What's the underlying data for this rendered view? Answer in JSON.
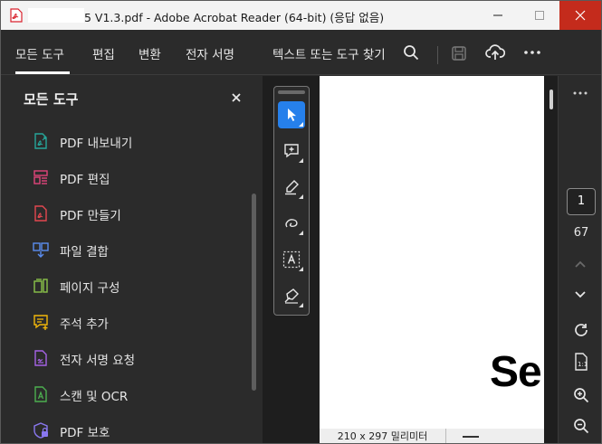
{
  "window": {
    "title": "5 V1.3.pdf - Adobe Acrobat Reader (64-bit) (응답 없음)"
  },
  "menubar": {
    "tabs": [
      "모든 도구",
      "편집",
      "변환",
      "전자 서명"
    ],
    "search_label": "텍스트 또는 도구 찾기"
  },
  "panel": {
    "title": "모든 도구",
    "tools": [
      {
        "label": "PDF 내보내기",
        "icon": "export-pdf-icon",
        "color": "#26a69a"
      },
      {
        "label": "PDF 편집",
        "icon": "edit-pdf-icon",
        "color": "#e0457b"
      },
      {
        "label": "PDF 만들기",
        "icon": "create-pdf-icon",
        "color": "#e34850"
      },
      {
        "label": "파일 결합",
        "icon": "combine-files-icon",
        "color": "#5b8def"
      },
      {
        "label": "페이지 구성",
        "icon": "organize-pages-icon",
        "color": "#8bc34a"
      },
      {
        "label": "주석 추가",
        "icon": "add-comment-icon",
        "color": "#f2b70a"
      },
      {
        "label": "전자 서명 요청",
        "icon": "request-signature-icon",
        "color": "#a663e6"
      },
      {
        "label": "스캔 및 OCR",
        "icon": "scan-ocr-icon",
        "color": "#4caf50"
      },
      {
        "label": "PDF 보호",
        "icon": "protect-pdf-icon",
        "color": "#8a78f0"
      }
    ]
  },
  "document": {
    "visible_text": "Se",
    "page_size_label": "210 x 297 밀리미터"
  },
  "navigation": {
    "current_page": "1",
    "total_pages": "67"
  },
  "colors": {
    "accent": "#2680eb",
    "close_button": "#c42b1c",
    "panel_bg": "#2b2b2b",
    "canvas_bg": "#1e1e1e"
  }
}
